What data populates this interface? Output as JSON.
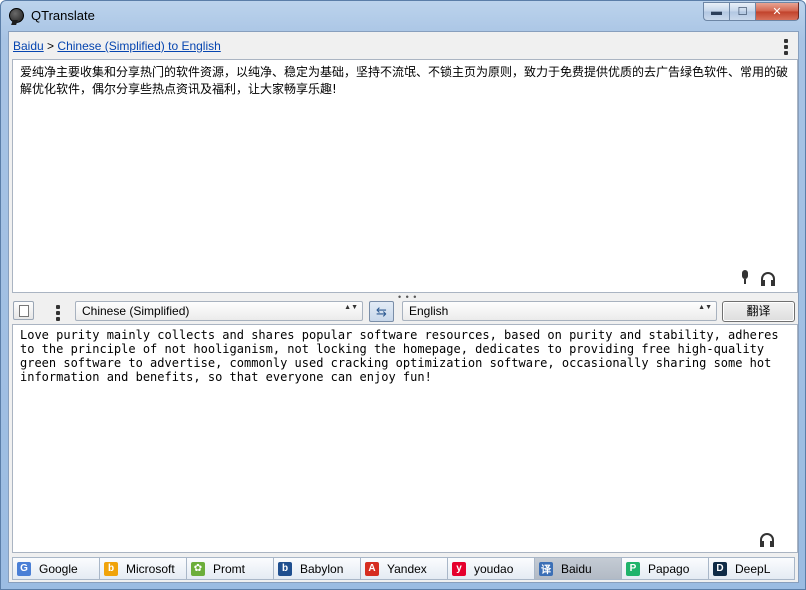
{
  "window": {
    "title": "QTranslate"
  },
  "window_controls": {
    "minimize": "▬",
    "maximize": "☐",
    "close": "✕"
  },
  "breadcrumb": {
    "service": "Baidu",
    "separator": ">",
    "direction": "Chinese (Simplified) to English"
  },
  "source": {
    "text": "爱纯净主要收集和分享热门的软件资源，以纯净、稳定为基础，坚持不流氓、不锁主页为原则，致力于免费提供优质的去广告绿色软件、常用的破解优化软件，偶尔分享些热点资讯及福利，让大家畅享乐趣!"
  },
  "toolbar": {
    "from_lang": "Chinese (Simplified)",
    "to_lang": "English",
    "swap_glyph": "⇆",
    "translate_label": "翻译",
    "combo_arrows": "▲▼",
    "grip": "• • •"
  },
  "result": {
    "text": "Love purity mainly collects and shares popular software resources, based on purity and stability, adheres to the principle of not hooliganism, not locking the homepage, dedicates to providing free high-quality green software to advertise, commonly used cracking optimization software, occasionally sharing some hot information and benefits, so that everyone can enjoy fun!"
  },
  "engines": [
    {
      "label": "Google",
      "icon": "google-icon",
      "glyph": "G",
      "color": "#4a7fd6",
      "active": false
    },
    {
      "label": "Microsoft",
      "icon": "bing-icon",
      "glyph": "b",
      "color": "#f0a30a",
      "active": false
    },
    {
      "label": "Promt",
      "icon": "promt-icon",
      "glyph": "✿",
      "color": "#6cae3a",
      "active": false
    },
    {
      "label": "Babylon",
      "icon": "babylon-icon",
      "glyph": "b",
      "color": "#1f4f8f",
      "active": false
    },
    {
      "label": "Yandex",
      "icon": "yandex-icon",
      "glyph": "A",
      "color": "#d62d20",
      "active": false
    },
    {
      "label": "youdao",
      "icon": "youdao-icon",
      "glyph": "y",
      "color": "#e5002d",
      "active": false
    },
    {
      "label": "Baidu",
      "icon": "baidu-icon",
      "glyph": "译",
      "color": "#3b6fb6",
      "active": true
    },
    {
      "label": "Papago",
      "icon": "papago-icon",
      "glyph": "P",
      "color": "#1fb36b",
      "active": false
    },
    {
      "label": "DeepL",
      "icon": "deepl-icon",
      "glyph": "D",
      "color": "#0f2b46",
      "active": false
    }
  ]
}
